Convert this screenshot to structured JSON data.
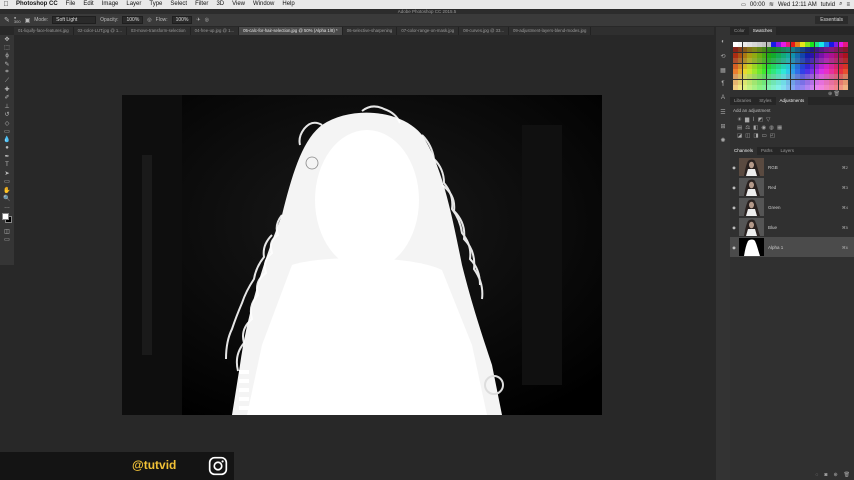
{
  "menubar": {
    "app_name": "Photoshop CC",
    "items": [
      "File",
      "Edit",
      "Image",
      "Layer",
      "Type",
      "Select",
      "Filter",
      "3D",
      "View",
      "Window",
      "Help"
    ],
    "window_title": "Adobe Photoshop CC 2015.5",
    "battery": "00:00",
    "time": "Wed 12:11 AM",
    "user": "tutvid"
  },
  "options": {
    "brush_size": "300",
    "mode_label": "Mode:",
    "mode_value": "Soft Light",
    "opacity_label": "Opacity:",
    "opacity_value": "100%",
    "flow_label": "Flow:",
    "flow_value": "100%",
    "workspace": "Essentials"
  },
  "doc_tabs": [
    {
      "label": "01-liquify-face-features.jpg",
      "active": false
    },
    {
      "label": "02-color-LUT.jpg @ 1...",
      "active": false
    },
    {
      "label": "03-move-transform-selection",
      "active": false
    },
    {
      "label": "04-free-up.jpg @ 1...",
      "active": false
    },
    {
      "label": "05-calc-for-hair-selection.jpg @ 50% (Alpha 1/8) *",
      "active": true
    },
    {
      "label": "06-selective-sharpening",
      "active": false
    },
    {
      "label": "07-color-range-on-mask.jpg",
      "active": false
    },
    {
      "label": "08-curves.jpg @ 33...",
      "active": false
    },
    {
      "label": "09-adjustment-layers-blend-modes.jpg",
      "active": false
    }
  ],
  "tools": [
    "move-tool",
    "marquee-tool",
    "lasso-tool",
    "quick-select-tool",
    "crop-tool",
    "eyedropper-tool",
    "healing-tool",
    "brush-tool",
    "clone-tool",
    "history-brush-tool",
    "eraser-tool",
    "gradient-tool",
    "blur-tool",
    "dodge-tool",
    "pen-tool",
    "type-tool",
    "path-select-tool",
    "shape-tool",
    "hand-tool",
    "zoom-tool",
    "more-tools"
  ],
  "swatches_panel": {
    "tabs": [
      {
        "label": "Color",
        "active": false
      },
      {
        "label": "Swatches",
        "active": true
      }
    ]
  },
  "adjustments_panel": {
    "tabs": [
      {
        "label": "Libraries",
        "active": false
      },
      {
        "label": "Styles",
        "active": false
      },
      {
        "label": "Adjustments",
        "active": true
      }
    ],
    "heading": "Add an adjustment"
  },
  "channels_panel": {
    "tabs": [
      {
        "label": "Channels",
        "active": true
      },
      {
        "label": "Paths",
        "active": false
      },
      {
        "label": "Layers",
        "active": false
      }
    ],
    "channels": [
      {
        "name": "RGB",
        "shortcut": "⌘2",
        "visible": true,
        "selected": false,
        "thumb": "color"
      },
      {
        "name": "Red",
        "shortcut": "⌘3",
        "visible": true,
        "selected": false,
        "thumb": "gray"
      },
      {
        "name": "Green",
        "shortcut": "⌘4",
        "visible": true,
        "selected": false,
        "thumb": "gray"
      },
      {
        "name": "Blue",
        "shortcut": "⌘5",
        "visible": true,
        "selected": false,
        "thumb": "gray"
      },
      {
        "name": "Alpha 1",
        "shortcut": "⌘6",
        "visible": true,
        "selected": true,
        "thumb": "mask"
      }
    ]
  },
  "watermark": {
    "handle": "@tutvid",
    "icon": "instagram-icon",
    "color": "#f2c237"
  },
  "colors": {
    "accent": "#f2c237",
    "panel_bg": "#303030",
    "canvas_bg": "#282828"
  }
}
